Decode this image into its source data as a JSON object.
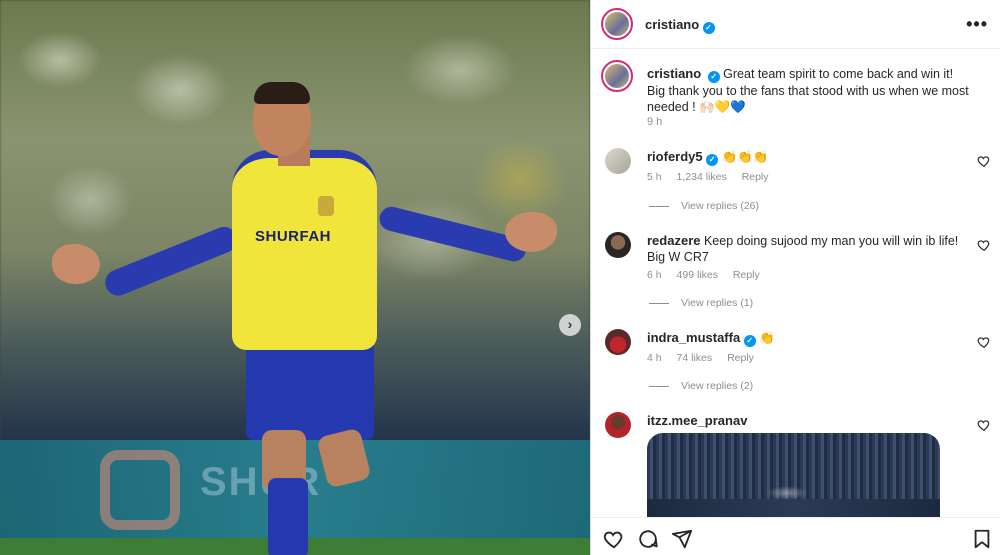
{
  "post": {
    "author": "cristiano",
    "caption_line1": "Great team spirit to come back and win it!",
    "caption_line2": "Big thank you to the fans that stood with us when we most needed ! 🙌🏻💛💙",
    "time": "9 h",
    "image_text": {
      "shirt_sponsor": "SHURFAH",
      "board_text": "SHUR"
    }
  },
  "header": {
    "username": "cristiano",
    "more_label": "•••"
  },
  "comments": [
    {
      "username": "rioferdy5",
      "text": "👏👏👏",
      "time": "5 h",
      "likes": "1,234 likes",
      "reply": "Reply",
      "view_replies": "View replies (26)"
    },
    {
      "username": "redazere",
      "text": "Keep doing sujood my man you will win ib life! Big W CR7",
      "time": "6 h",
      "likes": "499 likes",
      "reply": "Reply",
      "view_replies": "View replies (1)"
    },
    {
      "username": "indra_mustaffa",
      "text": "👏",
      "time": "4 h",
      "likes": "74 likes",
      "reply": "Reply",
      "view_replies": "View replies (2)"
    },
    {
      "username": "itzz.mee_pranav",
      "text": ""
    }
  ],
  "icons": {
    "verified": "verified-badge-icon",
    "next": "chevron-right-icon",
    "heart": "heart-icon",
    "comment": "comment-icon",
    "share": "paper-plane-icon",
    "save": "bookmark-icon"
  },
  "colors": {
    "verified_blue": "#0095f6",
    "meta_gray": "#8e8e8e",
    "shirt_yellow": "#f1e43a",
    "kit_blue": "#2a3bb0"
  }
}
